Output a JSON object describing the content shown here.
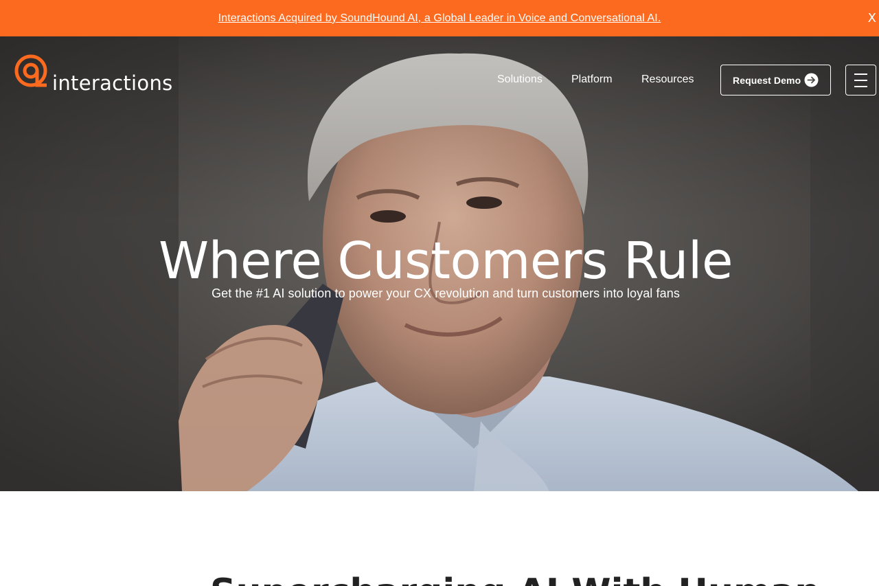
{
  "announcement": {
    "text": "Interactions Acquired by SoundHound AI, a Global Leader in Voice and Conversational AI.",
    "close_label": "X",
    "background": "#fb6a1f"
  },
  "brand": {
    "name": "interactions",
    "accent": "#fb6a1f",
    "logo_icon": "at-sign-logo-icon"
  },
  "nav": {
    "items": [
      {
        "label": "Solutions"
      },
      {
        "label": "Platform"
      },
      {
        "label": "Resources"
      }
    ],
    "cta_label": "Request Demo",
    "cta_icon": "arrow-right-circle-icon",
    "menu_icon": "hamburger-menu-icon"
  },
  "hero": {
    "title": "Where Customers Rule",
    "subtitle": "Get the #1 AI solution to power your CX revolution and turn customers into loyal fans",
    "image": "man-on-phone-photo"
  },
  "section": {
    "title_partial": "Supercharging AI With Human"
  }
}
